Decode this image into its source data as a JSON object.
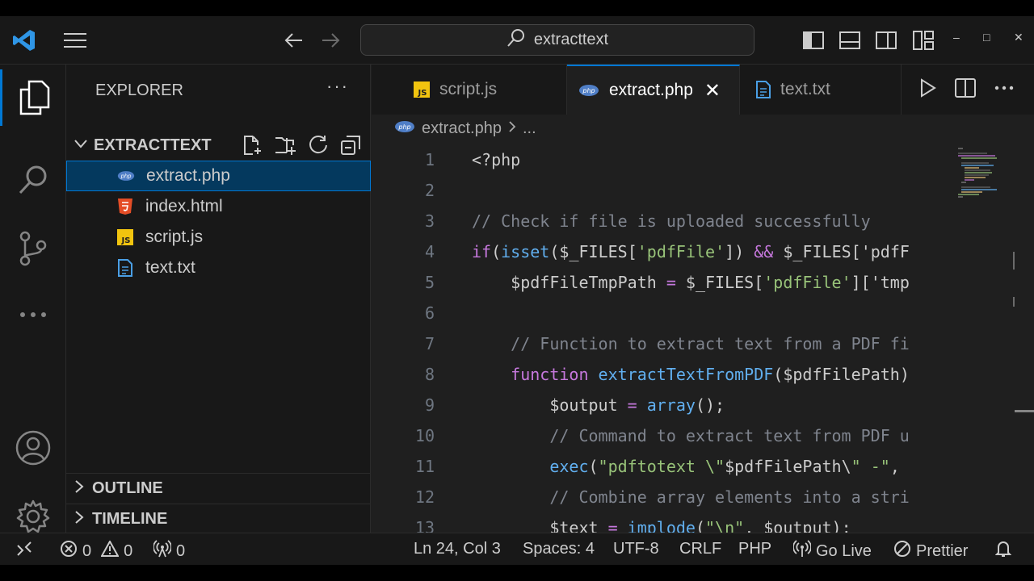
{
  "titlebar": {
    "search_text": "extracttext"
  },
  "sidebar": {
    "header": "EXPLORER",
    "folder": "EXTRACTTEXT",
    "files": [
      {
        "name": "extract.php",
        "icon": "php-icon",
        "selected": true
      },
      {
        "name": "index.html",
        "icon": "html5-icon",
        "selected": false
      },
      {
        "name": "script.js",
        "icon": "js-icon",
        "selected": false
      },
      {
        "name": "text.txt",
        "icon": "text-file-icon",
        "selected": false
      }
    ],
    "outline_label": "OUTLINE",
    "timeline_label": "TIMELINE"
  },
  "editor": {
    "tabs": [
      {
        "label": "script.js",
        "icon": "js-icon",
        "active": false
      },
      {
        "label": "extract.php",
        "icon": "php-icon",
        "active": true
      },
      {
        "label": "text.txt",
        "icon": "text-file-icon",
        "active": false
      }
    ],
    "breadcrumb": {
      "file": "extract.php",
      "more": "..."
    },
    "lines": [
      {
        "num": "1",
        "text": "<?php"
      },
      {
        "num": "2",
        "text": ""
      },
      {
        "num": "3",
        "text": "// Check if file is uploaded successfully"
      },
      {
        "num": "4",
        "text": "if(isset($_FILES['pdfFile']) && $_FILES['pdfF"
      },
      {
        "num": "5",
        "text": "    $pdfFileTmpPath = $_FILES['pdfFile']['tmp"
      },
      {
        "num": "6",
        "text": ""
      },
      {
        "num": "7",
        "text": "    // Function to extract text from a PDF fi"
      },
      {
        "num": "8",
        "text": "    function extractTextFromPDF($pdfFilePath)"
      },
      {
        "num": "9",
        "text": "        $output = array();"
      },
      {
        "num": "10",
        "text": "        // Command to extract text from PDF u"
      },
      {
        "num": "11",
        "text": "        exec(\"pdftotext \\\"$pdfFilePath\\\" -\","
      },
      {
        "num": "12",
        "text": "        // Combine array elements into a stri"
      },
      {
        "num": "13",
        "text": "        $text = implode(\"\\n\", $output);"
      }
    ]
  },
  "statusbar": {
    "errors": "0",
    "warnings": "0",
    "ports": "0",
    "position": "Ln 24, Col 3",
    "spaces": "Spaces: 4",
    "encoding": "UTF-8",
    "eol": "CRLF",
    "language": "PHP",
    "golive": "Go Live",
    "prettier": "Prettier"
  },
  "colors": {
    "accent": "#0078d4",
    "background": "#1f1f1f",
    "sidebar": "#181818",
    "selection": "#04395e"
  }
}
